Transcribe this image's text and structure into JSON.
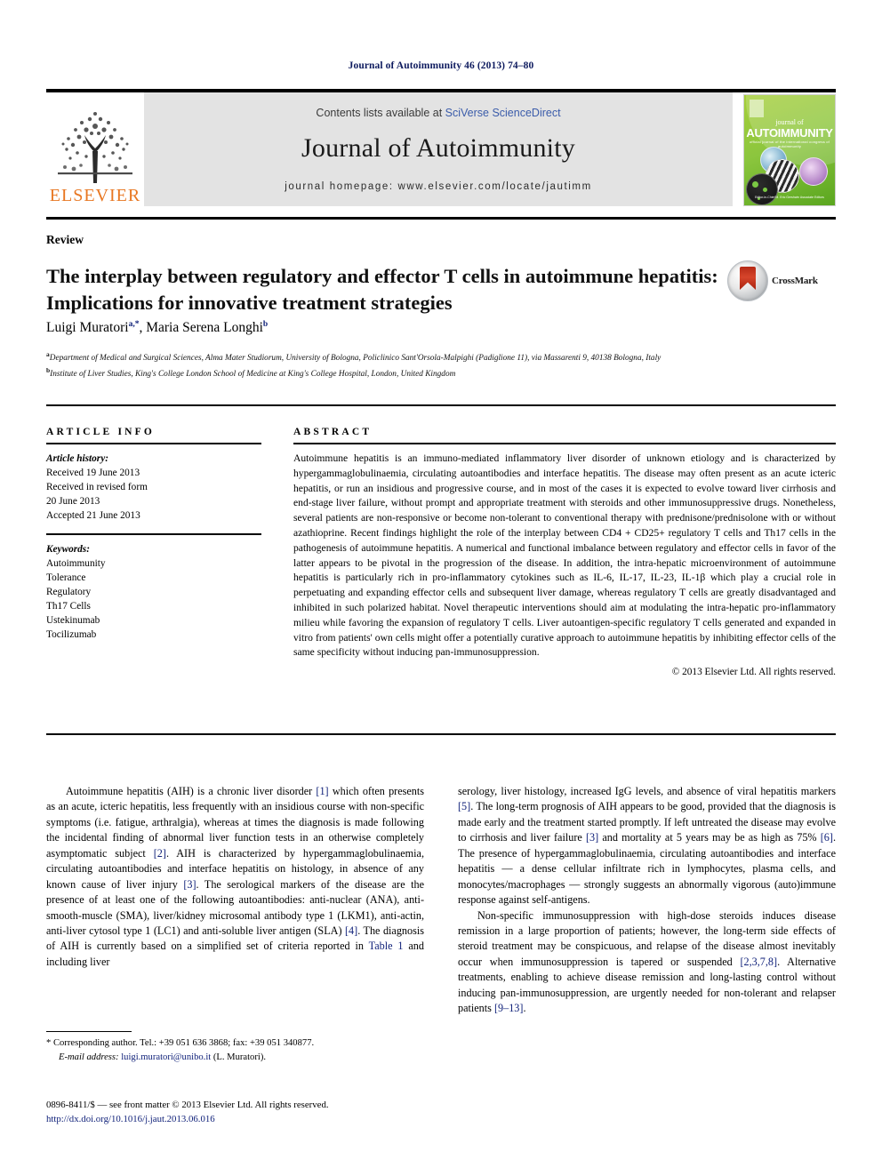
{
  "running_head": "Journal of Autoimmunity 46 (2013) 74–80",
  "masthead": {
    "elsevier_label": "ELSEVIER",
    "tree_icon": "elsevier-tree-icon",
    "contents_prefix": "Contents lists available at ",
    "contents_link": "SciVerse ScienceDirect",
    "journal_name": "Journal of Autoimmunity",
    "homepage": "journal homepage: www.elsevier.com/locate/jautimm",
    "cover": {
      "small_title": "journal of",
      "large_title": "AUTOIMMUNITY",
      "subtitle": "official journal of the international congress of autoimmunity",
      "footer": "Editor-in-Chief\nM. Eric Gershwin\nAssociate Editors"
    }
  },
  "article": {
    "type_label": "Review",
    "title": "The interplay between regulatory and effector T cells in autoimmune hepatitis: Implications for innovative treatment strategies",
    "authors_html": "Luigi Muratori<sup>a,*</sup>, Maria Serena Longhi<sup>b</sup>",
    "affiliation_a": "Department of Medical and Surgical Sciences, Alma Mater Studiorum, University of Bologna, Policlinico Sant'Orsola-Malpighi (Padiglione 11), via Massarenti 9, 40138 Bologna, Italy",
    "affiliation_b": "Institute of Liver Studies, King's College London School of Medicine at King's College Hospital, London, United Kingdom",
    "crossmark_label": "CrossMark",
    "crossmark_icon": "crossmark-icon"
  },
  "article_info": {
    "heading": "ARTICLE INFO",
    "history_label": "Article history:",
    "history_lines": [
      "Received 19 June 2013",
      "Received in revised form",
      "20 June 2013",
      "Accepted 21 June 2013"
    ],
    "keywords_label": "Keywords:",
    "keywords": [
      "Autoimmunity",
      "Tolerance",
      "Regulatory",
      "Th17 Cells",
      "Ustekinumab",
      "Tocilizumab"
    ]
  },
  "abstract": {
    "heading": "ABSTRACT",
    "text": "Autoimmune hepatitis is an immuno-mediated inflammatory liver disorder of unknown etiology and is characterized by hypergammaglobulinaemia, circulating autoantibodies and interface hepatitis. The disease may often present as an acute icteric hepatitis, or run an insidious and progressive course, and in most of the cases it is expected to evolve toward liver cirrhosis and end-stage liver failure, without prompt and appropriate treatment with steroids and other immunosuppressive drugs. Nonetheless, several patients are non-responsive or become non-tolerant to conventional therapy with prednisone/prednisolone with or without azathioprine. Recent findings highlight the role of the interplay between CD4 + CD25+ regulatory T cells and Th17 cells in the pathogenesis of autoimmune hepatitis. A numerical and functional imbalance between regulatory and effector cells in favor of the latter appears to be pivotal in the progression of the disease. In addition, the intra-hepatic microenvironment of autoimmune hepatitis is particularly rich in pro-inflammatory cytokines such as IL-6, IL-17, IL-23, IL-1β which play a crucial role in perpetuating and expanding effector cells and subsequent liver damage, whereas regulatory T cells are greatly disadvantaged and inhibited in such polarized habitat. Novel therapeutic interventions should aim at modulating the intra-hepatic pro-inflammatory milieu while favoring the expansion of regulatory T cells. Liver autoantigen-specific regulatory T cells generated and expanded in vitro from patients' own cells might offer a potentially curative approach to autoimmune hepatitis by inhibiting effector cells of the same specificity without inducing pan-immunosuppression.",
    "copyright": "© 2013 Elsevier Ltd. All rights reserved."
  },
  "body": {
    "left_paragraph_html": "Autoimmune hepatitis (AIH) is a chronic liver disorder <span class=\"ref\">[1]</span> which often presents as an acute, icteric hepatitis, less frequently with an insidious course with non-specific symptoms (i.e. fatigue, arthralgia), whereas at times the diagnosis is made following the incidental finding of abnormal liver function tests in an otherwise completely asymptomatic subject <span class=\"ref\">[2]</span>. AIH is characterized by hypergammaglobulinaemia, circulating autoantibodies and interface hepatitis on histology, in absence of any known cause of liver injury <span class=\"ref\">[3]</span>. The serological markers of the disease are the presence of at least one of the following autoantibodies: anti-nuclear (ANA), anti-smooth-muscle (SMA), liver/kidney microsomal antibody type 1 (LKM1), anti-actin, anti-liver cytosol type 1 (LC1) and anti-soluble liver antigen (SLA) <span class=\"ref\">[4]</span>. The diagnosis of AIH is currently based on a simplified set of criteria reported in <span class=\"tbl-link\">Table 1</span> and including liver",
    "right_paragraph_1_html": "serology, liver histology, increased IgG levels, and absence of viral hepatitis markers <span class=\"ref\">[5]</span>. The long-term prognosis of AIH appears to be good, provided that the diagnosis is made early and the treatment started promptly. If left untreated the disease may evolve to cirrhosis and liver failure <span class=\"ref\">[3]</span> and mortality at 5 years may be as high as 75% <span class=\"ref\">[6]</span>. The presence of hypergammaglobulinaemia, circulating autoantibodies and interface hepatitis — a dense cellular infiltrate rich in lymphocytes, plasma cells, and monocytes/macrophages — strongly suggests an abnormally vigorous (auto)immune response against self-antigens.",
    "right_paragraph_2_html": "Non-specific immunosuppression with high-dose steroids induces disease remission in a large proportion of patients; however, the long-term side effects of steroid treatment may be conspicuous, and relapse of the disease almost inevitably occur when immunosuppression is tapered or suspended <span class=\"ref\">[2,3,7,8]</span>. Alternative treatments, enabling to achieve disease remission and long-lasting control without inducing pan-immunosuppression, are urgently needed for non-tolerant and relapser patients <span class=\"ref\">[9–13]</span>."
  },
  "footnote": {
    "corresponding_html": "* Corresponding author. Tel.: +39 051 636 3868; fax: +39 051 340877.",
    "email_label": "E-mail address:",
    "email": "luigi.muratori@unibo.it",
    "email_suffix": "(L. Muratori)."
  },
  "footer": {
    "issn_line": "0896-8411/$ — see front matter © 2013 Elsevier Ltd. All rights reserved.",
    "doi": "http://dx.doi.org/10.1016/j.jaut.2013.06.016"
  }
}
